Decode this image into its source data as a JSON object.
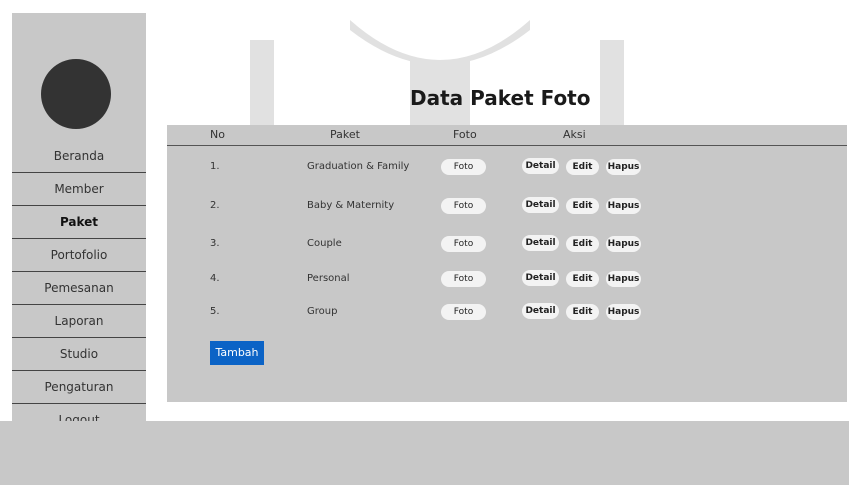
{
  "sidebar": {
    "items": [
      {
        "label": "Beranda"
      },
      {
        "label": "Member"
      },
      {
        "label": "Paket"
      },
      {
        "label": "Portofolio"
      },
      {
        "label": "Pemesanan"
      },
      {
        "label": "Laporan"
      },
      {
        "label": "Studio"
      },
      {
        "label": "Pengaturan"
      },
      {
        "label": "Logout"
      }
    ],
    "active": "Paket"
  },
  "page": {
    "title": "Data Paket Foto"
  },
  "table": {
    "headers": {
      "no": "No",
      "paket": "Paket",
      "foto": "Foto",
      "aksi": "Aksi"
    },
    "rows": [
      {
        "no": "1.",
        "paket": "Graduation & Family",
        "foto": "Foto",
        "detail": "Detail",
        "edit": "Edit",
        "hapus": "Hapus"
      },
      {
        "no": "2.",
        "paket": "Baby & Maternity",
        "foto": "Foto",
        "detail": "Detail",
        "edit": "Edit",
        "hapus": "Hapus"
      },
      {
        "no": "3.",
        "paket": "Couple",
        "foto": "Foto",
        "detail": "Detail",
        "edit": "Edit",
        "hapus": "Hapus"
      },
      {
        "no": "4.",
        "paket": "Personal",
        "foto": "Foto",
        "detail": "Detail",
        "edit": "Edit",
        "hapus": "Hapus"
      },
      {
        "no": "5.",
        "paket": "Group",
        "foto": "Foto",
        "detail": "Detail",
        "edit": "Edit",
        "hapus": "Hapus"
      }
    ]
  },
  "actions": {
    "add_label": "Tambah"
  },
  "colors": {
    "panel": "#c8c8c8",
    "accent": "#0b63c6",
    "avatar": "#333333"
  }
}
